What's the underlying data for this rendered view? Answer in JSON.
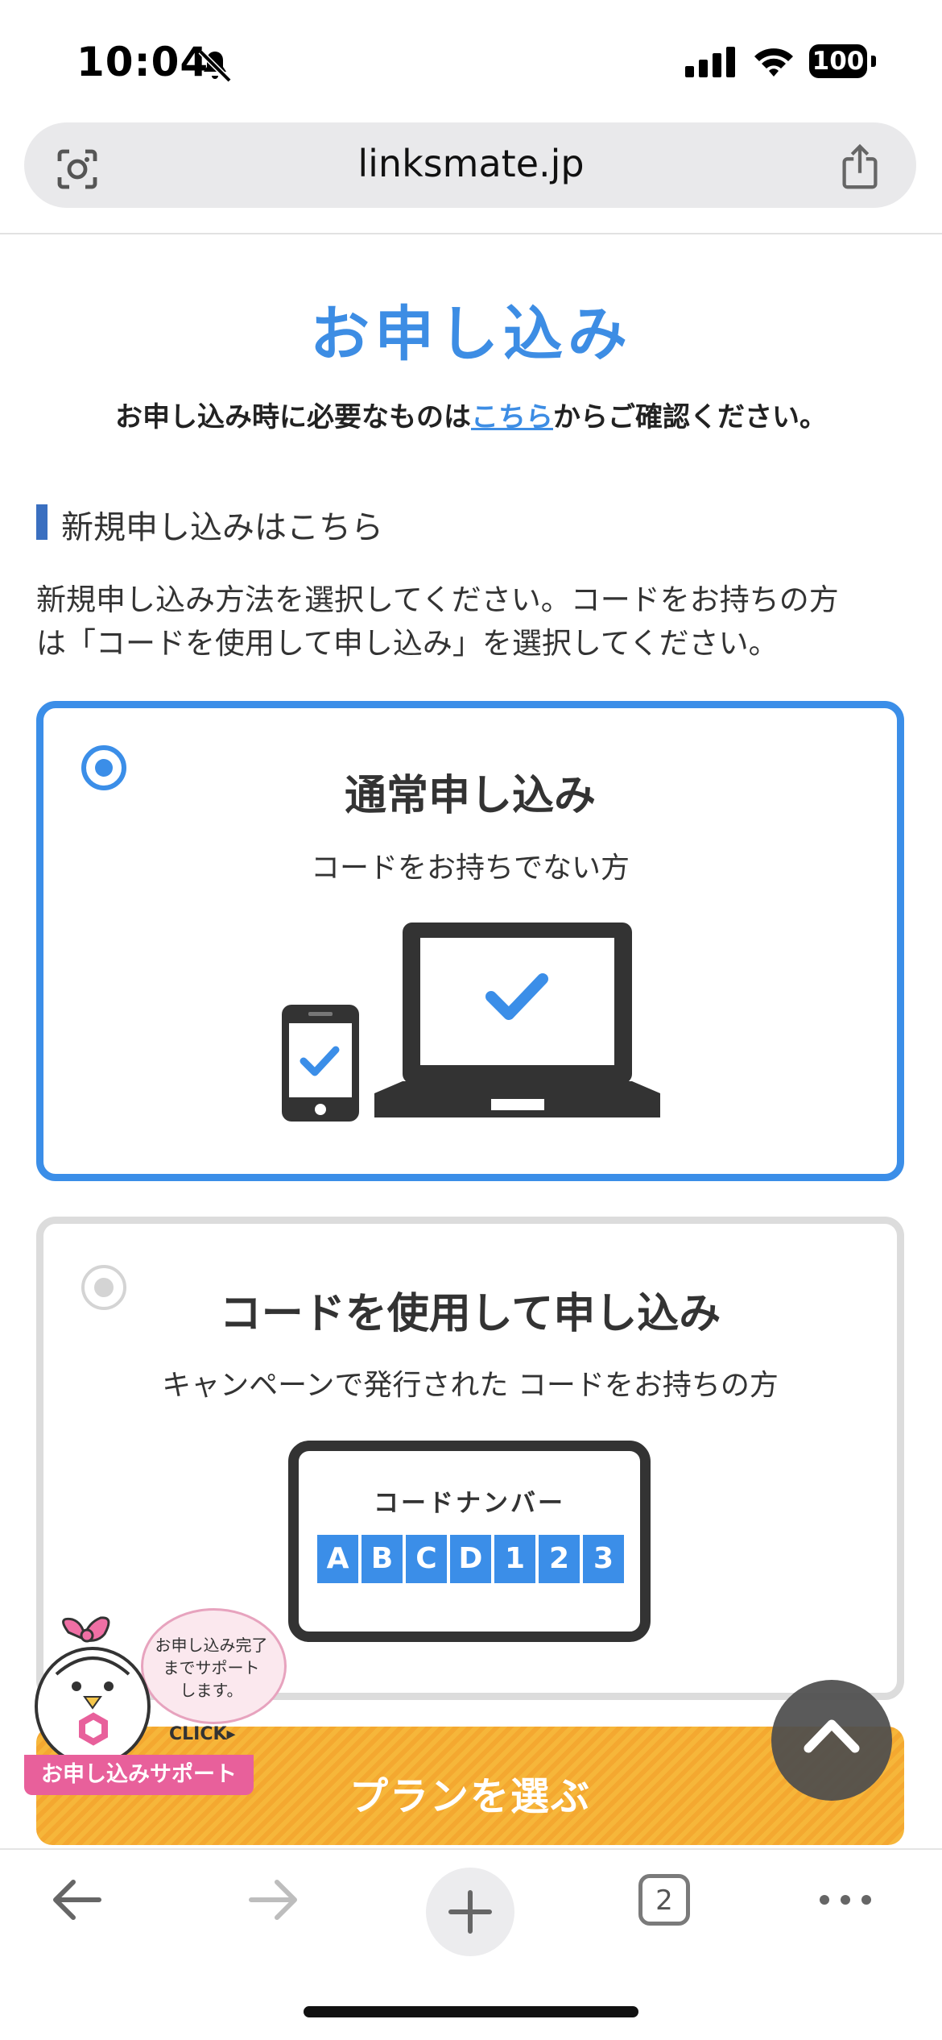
{
  "status_bar": {
    "time": "10:04",
    "battery": "100"
  },
  "browser": {
    "url": "linksmate.jp",
    "tab_count": "2"
  },
  "page": {
    "title": "お申し込み",
    "notice_prefix": "お申し込み時に必要なものは",
    "notice_link": "こちら",
    "notice_suffix": "からご確認ください。",
    "section_title": "新規申し込みはこちら",
    "description_line1": "新規申し込み方法を選択してください。コードをお持ちの方",
    "description_line2": "は「コードを使用して申し込み」を選択してください。"
  },
  "options": [
    {
      "title": "通常申し込み",
      "subtitle": "コードをお持ちでない方",
      "selected": true
    },
    {
      "title": "コードを使用して申し込み",
      "subtitle": "キャンペーンで発行された コードをお持ちの方",
      "selected": false,
      "code_card_label": "コードナンバー",
      "code_chars": [
        "A",
        "B",
        "C",
        "D",
        "1",
        "2",
        "3"
      ]
    }
  ],
  "cta": {
    "label": "プランを選ぶ"
  },
  "support_badge": {
    "bubble_line1": "お申し込み完了",
    "bubble_line2": "までサポート",
    "bubble_line3": "します。",
    "click": "CLICK",
    "label": "お申し込みサポート"
  },
  "colors": {
    "accent": "#3b8ee8",
    "cta": "#f4a830",
    "support": "#e8609b"
  },
  "icons": [
    "bell-slash-icon",
    "signal-icon",
    "wifi-icon",
    "battery-icon",
    "lens-icon",
    "share-icon",
    "back-icon",
    "forward-icon",
    "plus-icon",
    "tabs-icon",
    "more-icon",
    "scroll-top-icon"
  ]
}
